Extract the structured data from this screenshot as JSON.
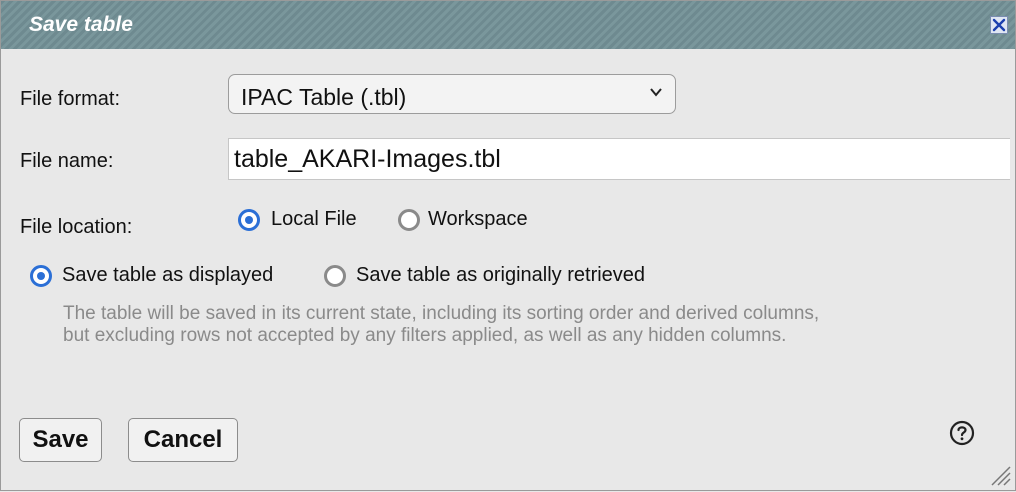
{
  "dialog": {
    "title": "Save table",
    "close_icon": "close-icon"
  },
  "form": {
    "file_format_label": "File format:",
    "file_format_value": "IPAC Table (.tbl)",
    "file_name_label": "File name:",
    "file_name_value": "table_AKARI-Images.tbl",
    "file_location_label": "File location:",
    "location_options": [
      {
        "label": "Local File",
        "selected": true
      },
      {
        "label": "Workspace",
        "selected": false
      }
    ],
    "save_mode_options": [
      {
        "label": "Save table as displayed",
        "selected": true
      },
      {
        "label": "Save table as originally retrieved",
        "selected": false
      }
    ],
    "description_line1": "The table will be saved in its current state, including its sorting order and derived columns,",
    "description_line2": "but excluding rows not accepted by any filters applied, as well as any hidden columns."
  },
  "buttons": {
    "save_label": "Save",
    "cancel_label": "Cancel"
  },
  "colors": {
    "accent": "#2b6fd6",
    "titlebar": "#738f95"
  }
}
